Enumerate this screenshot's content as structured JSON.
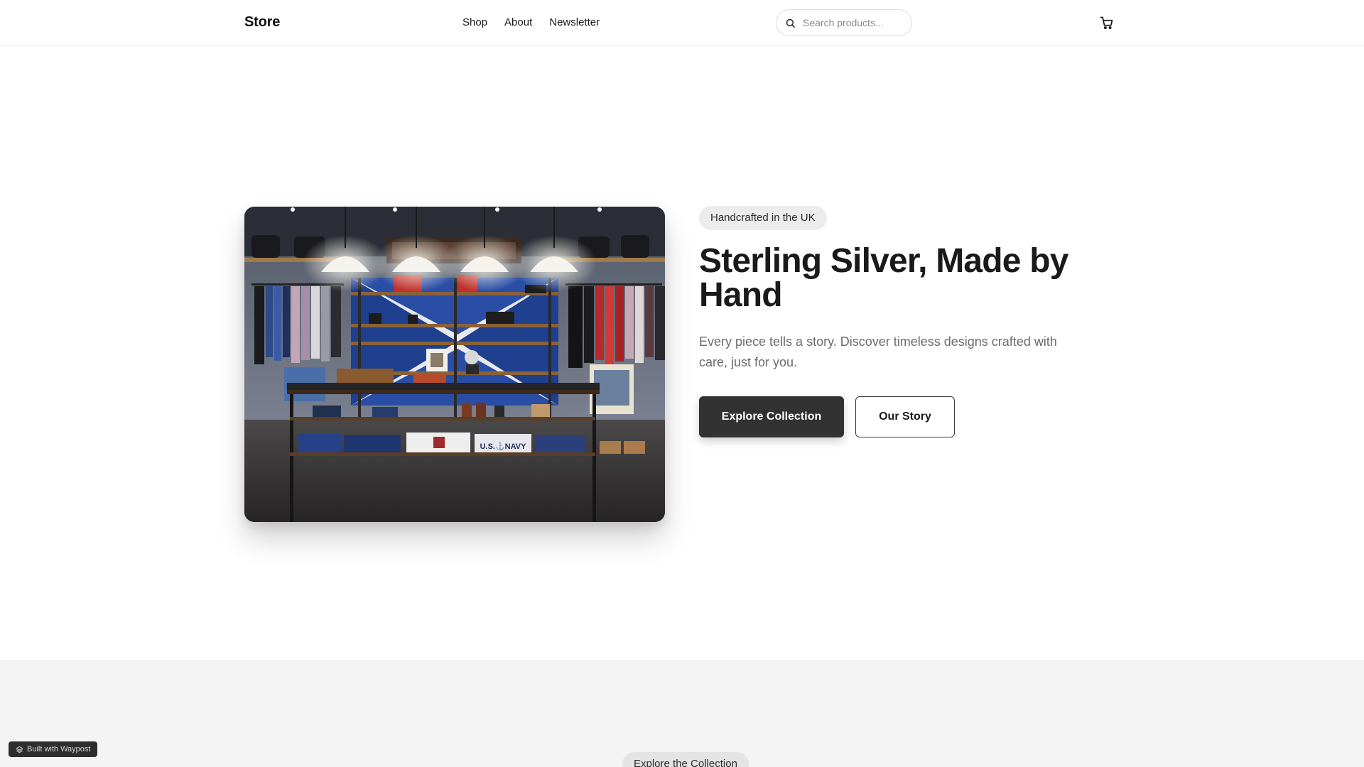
{
  "header": {
    "brand": "Store",
    "nav": [
      {
        "label": "Shop"
      },
      {
        "label": "About"
      },
      {
        "label": "Newsletter"
      }
    ],
    "search": {
      "placeholder": "Search products...",
      "icon": "search-icon"
    },
    "cart_icon": "cart-icon"
  },
  "hero": {
    "badge": "Handcrafted in the UK",
    "title": "Sterling Silver, Made by Hand",
    "subtitle": "Every piece tells a story. Discover timeless designs crafted with care, just for you.",
    "primary_button": "Explore Collection",
    "secondary_button": "Our Story",
    "image_store_text": "U.S.⚓NAVY"
  },
  "section": {
    "pill": "Explore the Collection"
  },
  "footer_badge": {
    "label": "Built with Waypost",
    "icon": "layers-icon"
  },
  "colors": {
    "primary_button": "#323232",
    "badge_bg": "#ececec",
    "lower_bg": "#f4f4f4"
  }
}
